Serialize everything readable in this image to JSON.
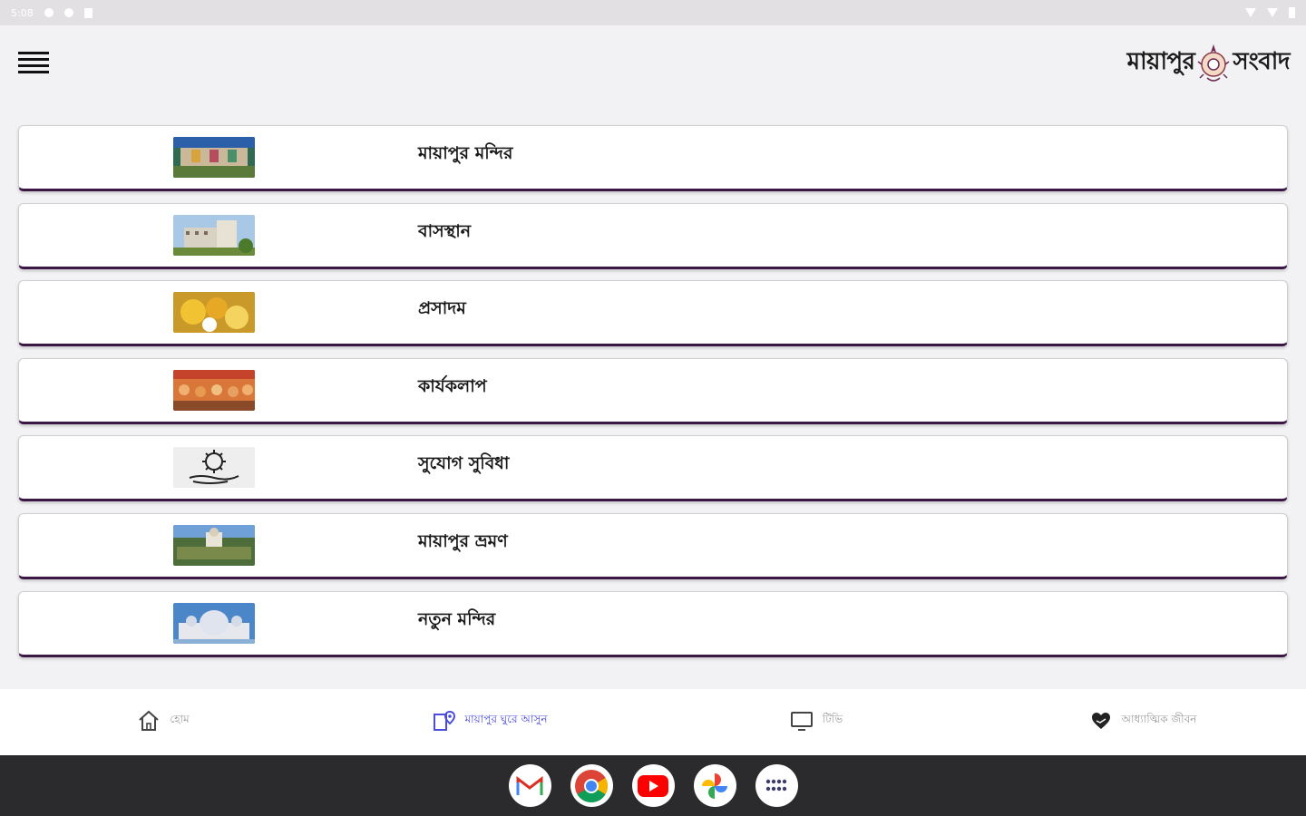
{
  "status_bar": {
    "time": "5:08"
  },
  "header": {
    "menu_icon": "hamburger-menu-icon",
    "brand_left": "মায়াপুর",
    "brand_right": "সংবাদ",
    "brand_emblem": "lotus-emblem-icon"
  },
  "list": {
    "items": [
      {
        "label": "মায়াপুর মন্দির",
        "thumbnail": "temple-gathering-photo"
      },
      {
        "label": "বাসস্থান",
        "thumbnail": "accommodation-building-photo"
      },
      {
        "label": "প্রসাদম",
        "thumbnail": "prasadam-food-photo"
      },
      {
        "label": "কার্যকলাপ",
        "thumbnail": "activities-crowd-photo"
      },
      {
        "label": "সুযোগ সুবিধা",
        "thumbnail": "facilities-hand-icon"
      },
      {
        "label": "মায়াপুর ভ্রমণ",
        "thumbnail": "mayapur-aerial-photo"
      },
      {
        "label": "নতুন মন্দির",
        "thumbnail": "new-temple-dome-photo"
      }
    ]
  },
  "bottom_nav": {
    "tabs": [
      {
        "label": "হোম",
        "icon": "home-icon",
        "active": false
      },
      {
        "label": "মায়াপুর ঘুরে আসুন",
        "icon": "map-pin-icon",
        "active": true
      },
      {
        "label": "টিভি",
        "icon": "tv-icon",
        "active": false
      },
      {
        "label": "আধ্যাত্মিক জীবন",
        "icon": "heart-hands-icon",
        "active": false
      }
    ]
  },
  "dock": {
    "apps": [
      "gmail-icon",
      "chrome-icon",
      "youtube-icon",
      "photos-icon",
      "app-drawer-icon"
    ]
  },
  "colors": {
    "accent": "#4c4cdc",
    "card_border_bottom": "#3a1745",
    "background": "#f2f1f3",
    "dock": "#2b2b2d"
  }
}
